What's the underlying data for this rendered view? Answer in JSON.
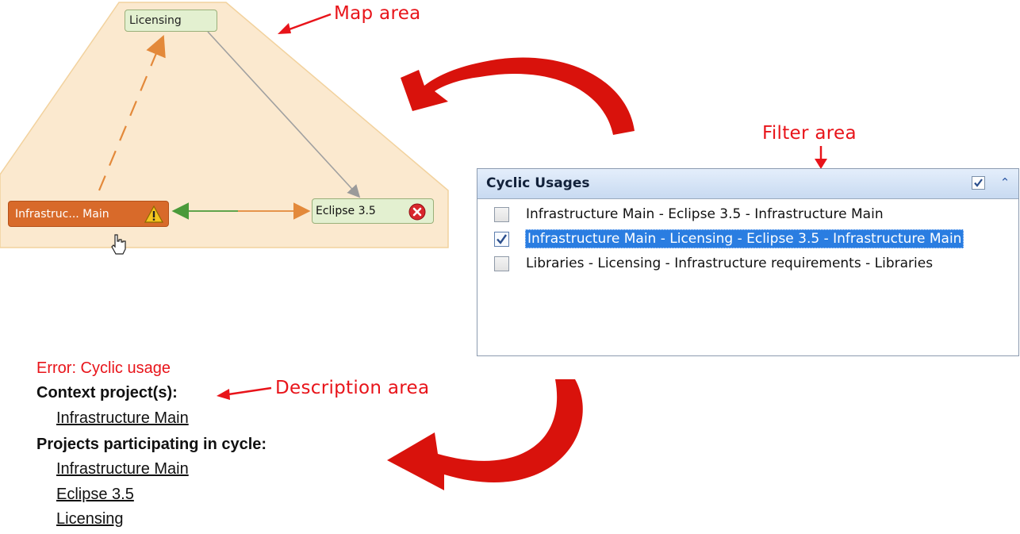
{
  "map": {
    "nodes": {
      "licensing": "Licensing",
      "infrastructure": "Infrastruc... Main",
      "eclipse": "Eclipse 3.5"
    },
    "node_colors": {
      "default_fill": "#e3f0d0",
      "error_fill": "#d86a2a",
      "connector_grey": "#a0a0a0",
      "connector_orange": "#e3893a",
      "connector_green": "#4a9a3a"
    }
  },
  "callouts": {
    "map": "Map area",
    "filter": "Filter area",
    "description": "Description area",
    "color": "#e8141a"
  },
  "filter_panel": {
    "title": "Cyclic Usages",
    "header_checked": true,
    "items": [
      {
        "label": "Infrastructure Main - Eclipse 3.5 - Infrastructure Main",
        "checked": false,
        "selected": false
      },
      {
        "label": "Infrastructure Main - Licensing - Eclipse 3.5 - Infrastructure Main",
        "checked": true,
        "selected": true
      },
      {
        "label": "Libraries - Licensing - Infrastructure requirements - Libraries",
        "checked": false,
        "selected": false
      }
    ],
    "selection_color": "#2a7de1"
  },
  "description": {
    "error": "Error: Cyclic usage",
    "context_heading": "Context project(s):",
    "context_projects": [
      "Infrastructure Main"
    ],
    "participants_heading": "Projects participating in cycle:",
    "participants": [
      "Infrastructure Main",
      "Eclipse 3.5",
      "Licensing"
    ]
  }
}
